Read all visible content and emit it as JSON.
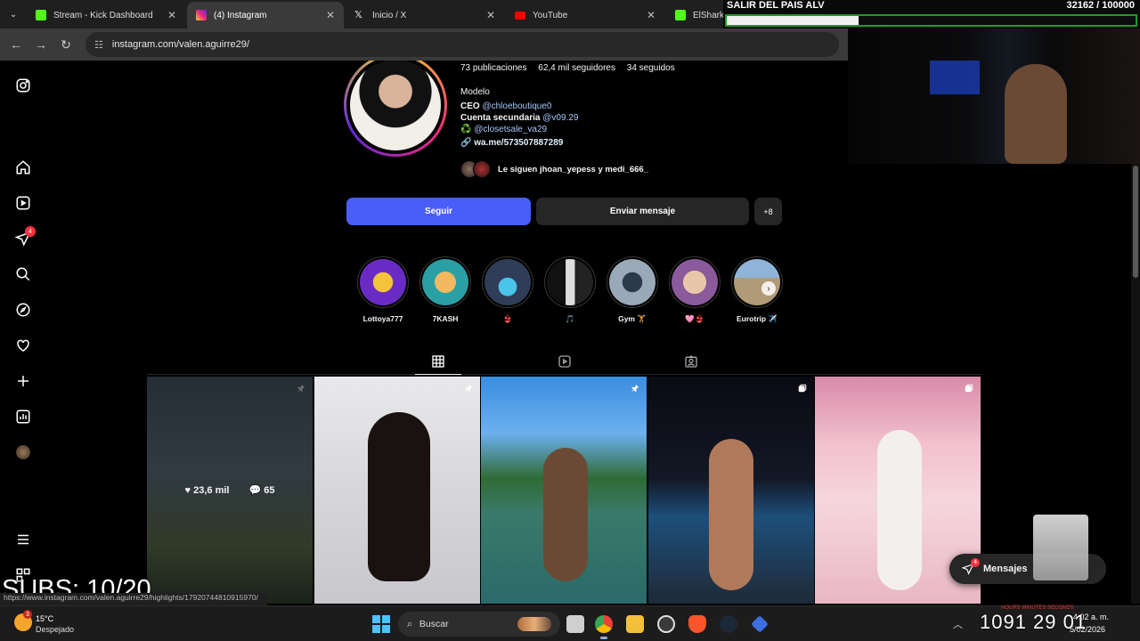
{
  "browser": {
    "tabs": [
      {
        "title": "Stream - Kick Dashboard",
        "favicon_color": "#53fc18",
        "active": false
      },
      {
        "title": "(4) Instagram",
        "favicon_color": "#e1306c",
        "active": true
      },
      {
        "title": "Inicio / X",
        "favicon_color": "#ffffff",
        "active": false
      },
      {
        "title": "YouTube",
        "favicon_color": "#ff0000",
        "active": false
      },
      {
        "title": "ElShark Stream - Watch Liv",
        "favicon_color": "#53fc18",
        "active": false
      }
    ],
    "close_glyph": "✕",
    "url": "instagram.com/valen.aguirre29/",
    "status_url": "https://www.instagram.com/valen.aguirre29/highlights/17920744810915970/"
  },
  "profile": {
    "stats": {
      "posts": "73 publicaciones",
      "followers": "62,4 mil seguidores",
      "following": "34 seguidos"
    },
    "category": "Modelo",
    "bio": {
      "ceo_label": "CEO",
      "ceo_mention": "@chloeboutique0",
      "secondary_label": "Cuenta secundaria",
      "secondary_mention": "@v09.29",
      "closet_icon": "♻️",
      "closet_mention": "@closetsale_va29",
      "link": "wa.me/573507887289"
    },
    "followed_by": "Le siguen jhoan_yepess y medi_666_",
    "buttons": {
      "follow": "Seguir",
      "message": "Enviar mensaje",
      "suggest": "+⁠8"
    }
  },
  "highlights": [
    {
      "label": "Lottoya777",
      "color": "#6a2bc4"
    },
    {
      "label": "7KASH",
      "color": "#2aa0a4"
    },
    {
      "label": "👙",
      "color": "#2f3d58"
    },
    {
      "label": "🎵",
      "color": "#3a3a3a"
    },
    {
      "label": "Gym 🏋",
      "color": "#4a5a6a"
    },
    {
      "label": "🩷👙",
      "color": "#b48a6a"
    },
    {
      "label": "Eurotrip ✈️",
      "color": "#9a8a70"
    }
  ],
  "posts": [
    {
      "likes": "23,6 mil",
      "comments": "65",
      "bg": "linear-gradient(180deg,#3a4652 0%,#4b5a66 40%,#4a5a3e 75%,#2c3528 100%)",
      "badge": "pin"
    },
    {
      "bg": "linear-gradient(180deg,#e9e9ec 0%,#d7d7da 50%,#c8c8cc 100%)",
      "badge": "pin"
    },
    {
      "bg": "linear-gradient(180deg,#3a8de0 0%,#6cb0ef 25%,#2f6b35 45%,#3a7a6a 60%,#2a6a6a 100%)",
      "badge": "pin"
    },
    {
      "bg": "linear-gradient(180deg,#0a0a12 0%,#121826 45%,#1d4f7a 62%,#1e2a38 100%)",
      "badge": "multi"
    },
    {
      "bg": "linear-gradient(180deg,#d98aa8 0%,#f2c1cf 30%,#f5d6de 55%,#e9b7c4 100%)",
      "badge": "multi"
    }
  ],
  "messages": {
    "label": "Mensajes",
    "badge": "4"
  },
  "sidebar": {
    "notif_badge": "4"
  },
  "stream_overlay": {
    "goal_title": "SALIR DEL PAIS ALV",
    "goal_count": "32162  / 100000",
    "goal_progress": 0.32162,
    "subs": "SUBS: 10/20",
    "timer": "1091  29  01",
    "timer_labels": "HOURS          MINUTES          SECONDS"
  },
  "taskbar": {
    "weather_temp": "15°C",
    "weather_desc": "Despejado",
    "weather_badge": "3",
    "search_placeholder": "Buscar",
    "time": "4:02 a. m.",
    "date": "5/02/2026"
  }
}
